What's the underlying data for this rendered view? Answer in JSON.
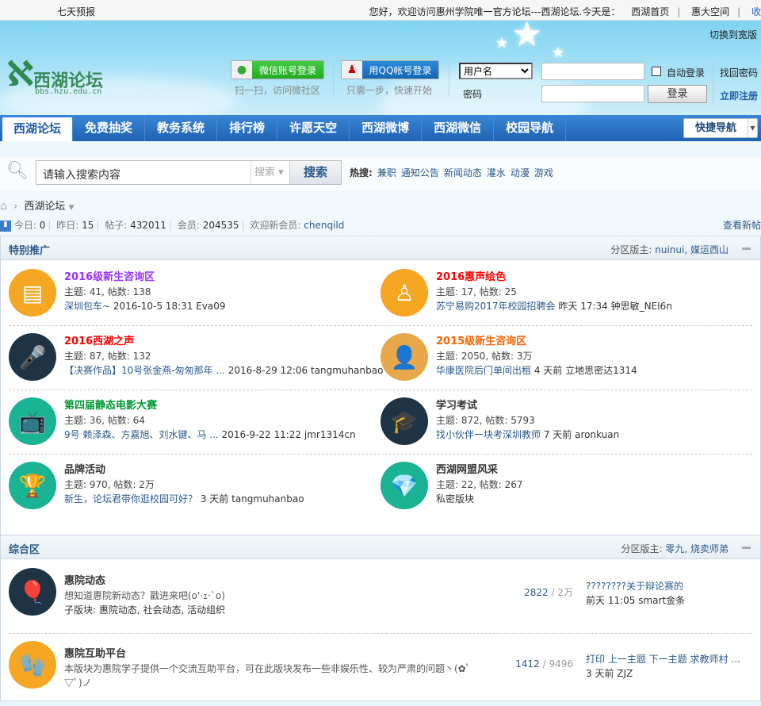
{
  "topbar": {
    "weather": "七天预报",
    "welcome": "您好，欢迎访问惠州学院唯一官方论坛---西湖论坛.今天是：",
    "links": [
      "西湖首页",
      "惠大空间",
      "收"
    ]
  },
  "header": {
    "switch_wide": "切换到宽版",
    "logo_name": "西湖论坛",
    "logo_url": "bbs.hzu.edu.cn",
    "wechat_login": "微信账号登录",
    "wechat_caption": "扫一扫，访问微社区",
    "qq_login": "用QQ帐号登录",
    "qq_caption": "只需一步，快速开始",
    "username_select": "用户名",
    "password_label": "密码",
    "auto_login": "自动登录",
    "login_button": "登录",
    "forgot_password": "找回密码",
    "register": "立即注册"
  },
  "nav": {
    "items": [
      "西湖论坛",
      "免费抽奖",
      "教务系统",
      "排行榜",
      "许愿天空",
      "西湖微博",
      "西湖微信",
      "校园导航"
    ],
    "quick_nav": "快捷导航"
  },
  "search": {
    "placeholder": "请输入搜索内容",
    "type": "搜索",
    "button": "搜索",
    "hot_label": "热搜:",
    "hot": [
      "兼职",
      "通知公告",
      "新闻动态",
      "灌水",
      "动漫",
      "游戏"
    ]
  },
  "breadcrumb": {
    "current": "西湖论坛"
  },
  "stats": {
    "today_label": "今日:",
    "today": "0",
    "yesterday_label": "昨日:",
    "yesterday": "15",
    "posts_label": "帖子:",
    "posts": "432011",
    "members_label": "会员:",
    "members": "204535",
    "new_member_label": "欢迎新会员:",
    "new_member": "chenqild",
    "view_new": "查看新帖"
  },
  "sections": [
    {
      "title": "特别推广",
      "mod_label": "分区版主:",
      "mods": "nuinui, 媒运西山",
      "forums": [
        {
          "name": "2016级新生咨询区",
          "color": "#9933ff",
          "stats": "主题: 41, 帖数: 138",
          "last_link": "深圳包车~",
          "last_meta": "2016-10-5 18:31 Eva09",
          "icon": "chat-bubble-icon",
          "bg": "#f5a623",
          "glyph": "▤"
        },
        {
          "name": "2016惠声绘色",
          "color": "#ff0000",
          "stats": "主题: 17, 帖数: 25",
          "last_link": "苏宁易购2017年校园招聘会",
          "last_meta": "昨天 17:34 钟思敏_NEI6n",
          "icon": "bowling-pins-icon",
          "bg": "#f5a623",
          "glyph": "♙"
        },
        {
          "name": "2016西湖之声",
          "color": "#ff0000",
          "stats": "主题: 87, 帖数: 132",
          "last_link": "【决赛作品】10号张金燕-匆匆那年 ...",
          "last_meta": "2016-8-29 12:06 tangmuhanbao",
          "icon": "microphone-icon",
          "bg": "#1e3444",
          "glyph": "🎤"
        },
        {
          "name": "2015级新生咨询区",
          "color": "#ff6600",
          "stats": "主题: 2050, 帖数: 3万",
          "last_link": "华康医院后门单间出租",
          "last_meta": "4 天前  立地思密达1314",
          "icon": "user-chat-icon",
          "bg": "#e8a84a",
          "glyph": "👤"
        },
        {
          "name": "第四届静态电影大赛",
          "color": "#009933",
          "stats": "主题: 36, 帖数: 64",
          "last_link": "9号 赖泽森、方嘉旭、刘水键、马 ...",
          "last_meta": "2016-9-22 11:22 jmr1314cn",
          "icon": "tv-icon",
          "bg": "#1ab394",
          "glyph": "📺"
        },
        {
          "name": "学习考试",
          "color": "#333333",
          "stats": "主题: 872, 帖数: 5793",
          "last_link": "找小伙伴一块考深圳教师",
          "last_meta": "7 天前  aronkuan",
          "icon": "graduation-cap-icon",
          "bg": "#1e3444",
          "glyph": "🎓"
        },
        {
          "name": "品牌活动",
          "color": "#333333",
          "stats": "主题: 970, 帖数: 2万",
          "last_link": "新生，论坛君带你逛校园可好？",
          "last_meta": "3 天前  tangmuhanbao",
          "icon": "trophy-icon",
          "bg": "#1ab394",
          "glyph": "🏆"
        },
        {
          "name": "西湖网盟风采",
          "color": "#333333",
          "stats": "主题: 22, 帖数: 267",
          "last_link": "",
          "last_meta": "私密版块",
          "icon": "diamond-icon",
          "bg": "#1ab394",
          "glyph": "💎"
        }
      ]
    },
    {
      "title": "综合区",
      "mod_label": "分区版主:",
      "mods": "零九, 烧卖师弟",
      "forums": [
        {
          "name": "惠院动态",
          "desc": "想知道惠院新动态？戳进来吧(o'·ｪ·`o)",
          "sub": "子版块: 惠院动态, 社会动态, 活动组织",
          "threads": "2822",
          "posts": "2万",
          "last_link": "????????关于辩论赛的",
          "last_meta": "前天 11:05 smart金条",
          "icon": "hot-air-balloon-icon",
          "bg": "#1e3444",
          "glyph": "🎈"
        },
        {
          "name": "惠院互助平台",
          "desc": "本版块为惠院学子提供一个交流互助平台，可在此版块发布一些非娱乐性、较为严肃的问题丶(✿ﾟ▽ﾟ)ノ",
          "sub": "",
          "threads": "1412",
          "posts": "9496",
          "last_link": "打印 上一主题 下一主题 求教师村 ...",
          "last_meta": "3 天前  ZJZ",
          "icon": "mitten-icon",
          "bg": "#f5a623",
          "glyph": "🧤"
        }
      ]
    }
  ]
}
